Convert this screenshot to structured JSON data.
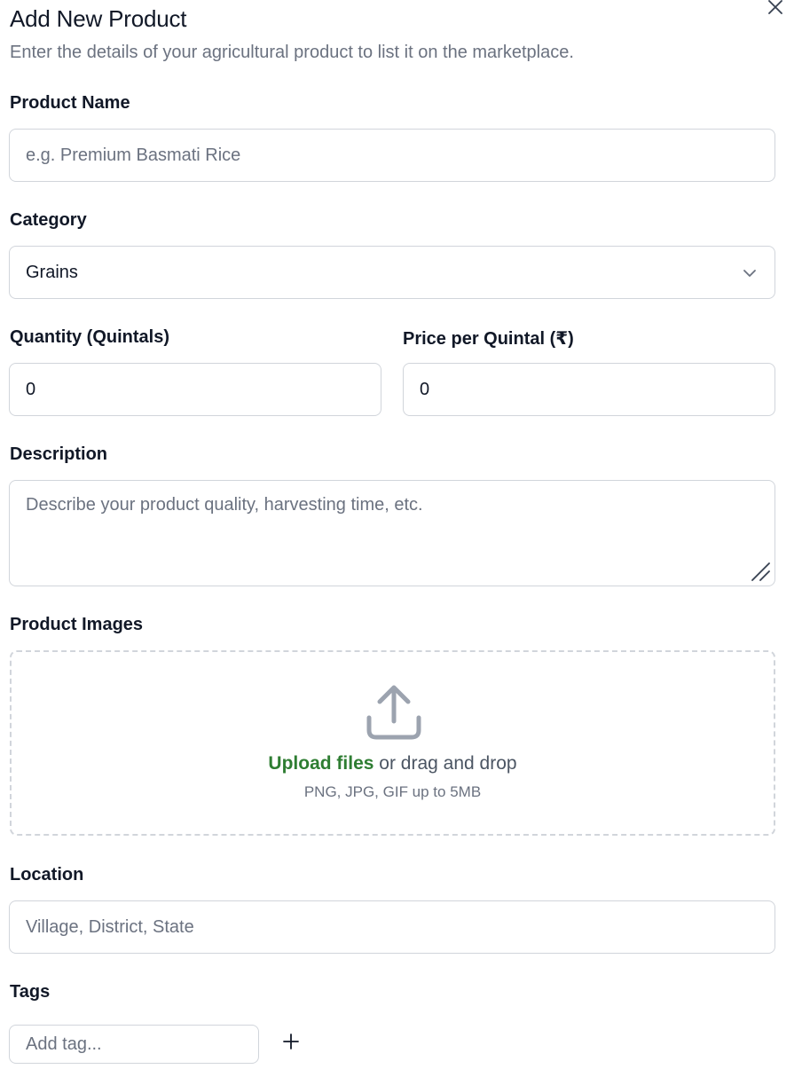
{
  "dialog": {
    "title": "Add New Product",
    "subtitle": "Enter the details of your agricultural product to list it on the marketplace.",
    "close_icon": "close-icon"
  },
  "product_name": {
    "label": "Product Name",
    "value": "",
    "placeholder": "e.g. Premium Basmati Rice"
  },
  "category": {
    "label": "Category",
    "selected": "Grains",
    "icon": "chevron-down-icon"
  },
  "quantity": {
    "label": "Quantity (Quintals)",
    "value": "0"
  },
  "price": {
    "label": "Price per Quintal (₹)",
    "value": "0"
  },
  "description": {
    "label": "Description",
    "placeholder": "Describe your product quality, harvesting time, etc."
  },
  "images": {
    "label": "Product Images",
    "icon": "upload-icon",
    "link_text": "Upload files",
    "rest_text": " or drag and drop",
    "hint": "PNG, JPG, GIF up to 5MB"
  },
  "location": {
    "label": "Location",
    "value": "",
    "placeholder": "Village, District, State"
  },
  "tags": {
    "label": "Tags",
    "placeholder": "Add tag...",
    "add_icon": "plus-icon"
  },
  "colors": {
    "accent": "#2e7d32",
    "border": "#d1d5db",
    "muted": "#6b7280"
  }
}
